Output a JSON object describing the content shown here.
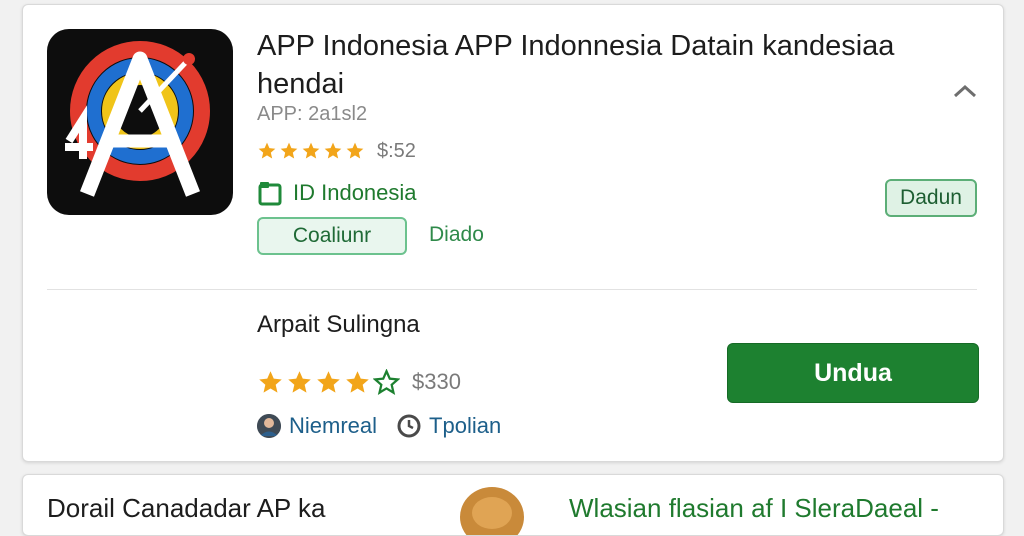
{
  "app": {
    "title": "APP Indonesia APP Indonnesia Datain kandesiaa hendai",
    "meta": "APP: 2a1sl2",
    "rating": 5,
    "price": "$:52",
    "developer": "ID Indonesia",
    "primary_outline_button": "Coaliunr",
    "secondary_link": "Diado",
    "small_button": "Dadun"
  },
  "section": {
    "title": "Arpait Sulingna",
    "rating": 4,
    "price": "$330",
    "download_button": "Undua",
    "chips": [
      "Niemreal",
      "Tpolian"
    ]
  },
  "next_card": {
    "title": "Dorail Canadadar AP ka",
    "link": "Wlasian flasian af I SleraDaeal -"
  },
  "icons": {
    "collapse": "chevron-up-icon",
    "developer": "folder-icon",
    "clock": "clock-icon"
  },
  "colors": {
    "accent_green": "#1d8130",
    "star": "#f2a51a"
  }
}
